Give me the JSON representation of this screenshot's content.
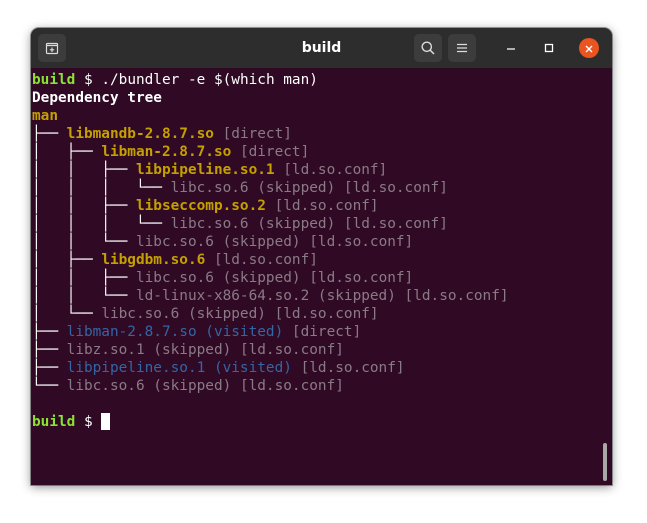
{
  "window": {
    "title": "build"
  },
  "terminal": {
    "prompt": "build",
    "prompt_suffix": " $ ",
    "command": "./bundler -e $(which man)",
    "heading": "Dependency tree",
    "root": "man",
    "tree": [
      {
        "prefix": "├── ",
        "name": "libmandb-2.8.7.so",
        "tag": " [direct]",
        "style": "yb"
      },
      {
        "prefix": "│   ├── ",
        "name": "libman-2.8.7.so",
        "tag": " [direct]",
        "style": "yb"
      },
      {
        "prefix": "│   │   ├── ",
        "name": "libpipeline.so.1",
        "tag": " [ld.so.conf]",
        "style": "yb"
      },
      {
        "prefix": "│   │   │   └── ",
        "name": "libc.so.6 (skipped)",
        "tag": " [ld.so.conf]",
        "style": "d"
      },
      {
        "prefix": "│   │   ├── ",
        "name": "libseccomp.so.2",
        "tag": " [ld.so.conf]",
        "style": "yb"
      },
      {
        "prefix": "│   │   │   └── ",
        "name": "libc.so.6 (skipped)",
        "tag": " [ld.so.conf]",
        "style": "d"
      },
      {
        "prefix": "│   │   └── ",
        "name": "libc.so.6 (skipped)",
        "tag": " [ld.so.conf]",
        "style": "d"
      },
      {
        "prefix": "│   ├── ",
        "name": "libgdbm.so.6",
        "tag": " [ld.so.conf]",
        "style": "yb"
      },
      {
        "prefix": "│   │   ├── ",
        "name": "libc.so.6 (skipped)",
        "tag": " [ld.so.conf]",
        "style": "d"
      },
      {
        "prefix": "│   │   └── ",
        "name": "ld-linux-x86-64.so.2 (skipped)",
        "tag": " [ld.so.conf]",
        "style": "d"
      },
      {
        "prefix": "│   └── ",
        "name": "libc.so.6 (skipped)",
        "tag": " [ld.so.conf]",
        "style": "d"
      },
      {
        "prefix": "├── ",
        "name": "libman-2.8.7.so (visited)",
        "tag": " [direct]",
        "style": "b"
      },
      {
        "prefix": "├── ",
        "name": "libz.so.1 (skipped)",
        "tag": " [ld.so.conf]",
        "style": "d"
      },
      {
        "prefix": "├── ",
        "name": "libpipeline.so.1 (visited)",
        "tag": " [ld.so.conf]",
        "style": "b"
      },
      {
        "prefix": "└── ",
        "name": "libc.so.6 (skipped)",
        "tag": " [ld.so.conf]",
        "style": "d"
      }
    ]
  },
  "icons": {
    "new_tab": "new-tab-icon",
    "search": "search-icon",
    "menu": "hamburger-menu-icon",
    "minimize": "minimize-icon",
    "maximize": "maximize-icon",
    "close": "close-icon"
  },
  "colors": {
    "terminal_bg": "#300a24",
    "titlebar_bg": "#2d2d2d",
    "prompt_green": "#8ae234",
    "library_yellow": "#c4a000",
    "skipped_gray": "#8a7a86",
    "visited_blue": "#3465a4",
    "close_orange": "#e95420"
  }
}
